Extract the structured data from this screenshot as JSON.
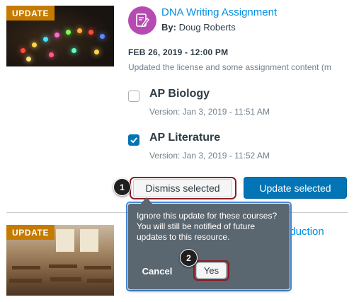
{
  "resource1": {
    "badge": "UPDATE",
    "title": "DNA Writing Assignment",
    "author_label": "By:",
    "author_name": "Doug Roberts",
    "date": "FEB 26, 2019 - 12:00 PM",
    "description": "Updated the license and some assignment content (m",
    "icon": "assignment-edit-icon",
    "icon_color": "#b64ab2"
  },
  "courses": [
    {
      "name": "AP Biology",
      "version": "Version: Jan 3, 2019 - 11:51 AM",
      "checked": false
    },
    {
      "name": "AP Literature",
      "version": "Version: Jan 3, 2019 - 11:52 AM",
      "checked": true
    }
  ],
  "actions": {
    "dismiss_label": "Dismiss selected",
    "update_label": "Update selected"
  },
  "callouts": {
    "step1": "1",
    "step2": "2"
  },
  "resource2": {
    "badge": "UPDATE",
    "title_partial": "roduction"
  },
  "popover": {
    "text": "Ignore this update for these courses? You will still be notified of future updates to this resource.",
    "cancel_label": "Cancel",
    "yes_label": "Yes"
  },
  "colors": {
    "link": "#008ee2",
    "primary": "#0374b5",
    "badge": "#c57b00",
    "highlight": "#8b1d24",
    "popover_bg": "#5b6770"
  }
}
